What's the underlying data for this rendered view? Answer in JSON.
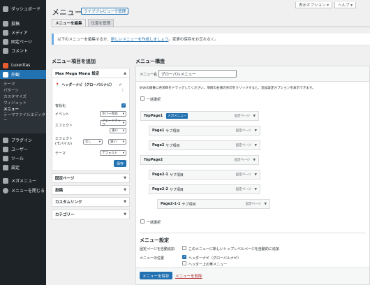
{
  "sidebar": {
    "dashboard": "ダッシュボード",
    "items": [
      "投稿",
      "メディア",
      "固定ページ",
      "コメント"
    ],
    "luxeritas": "Luxeritas",
    "appearance": "外観",
    "appearance_sub": [
      "テーマ",
      "パターン",
      "カスタマイズ",
      "ウィジェット",
      "メニュー",
      "テーマファイルエディター"
    ],
    "items2": [
      "プラグイン",
      "ユーザー",
      "ツール",
      "設定"
    ],
    "megamenu": "メガメニュー",
    "collapse": "メニューを閉じる"
  },
  "header": {
    "screen_options": "表示オプション ▾",
    "help": "ヘルプ ▾",
    "title": "メニュー",
    "live_preview": "ライブプレビューで管理"
  },
  "tabs": [
    "メニューを編集",
    "位置を管理"
  ],
  "notice": {
    "prefix": "以下のメニューを編集するか、",
    "link": "新しいメニューを作成しましょう",
    "suffix": "。変更の保存をお忘れなく。"
  },
  "left": {
    "heading": "メニュー項目を追加",
    "mega_panel_title": "Max Mega Menu 設定",
    "location_label": "ヘッダーナビ（グローバルナビ）",
    "enable_label": "有効化",
    "event_label": "イベント",
    "event_value": "ホバー有効",
    "effect_label": "エフェクト",
    "effect_value": "フェードアップ",
    "speed_value": "速い",
    "effect_mobile_label": "エフェクト (モバイル)",
    "effect_mobile_value": "なし",
    "effect_mobile_speed": "速い",
    "theme_label": "テーマ",
    "theme_value": "デフォルト",
    "save_label": "保存",
    "accordions": [
      "固定ページ",
      "投稿",
      "カスタムリンク",
      "カテゴリー"
    ]
  },
  "right": {
    "heading": "メニュー構造",
    "name_label": "メニュー名",
    "name_value": "グローバルメニュー",
    "instruction": "好みの順番に各項目をドラッグしてください。項目の右側の矢印をクリックすると、追加設定オプションを表示できます。",
    "bulk_select": "一括選択",
    "items": [
      {
        "title": "TopPage1",
        "sub": "",
        "mega": "メガメニュー",
        "type": "固定ページ"
      },
      {
        "title": "Page1",
        "sub": "サブ項目",
        "mega": "",
        "type": "固定ページ"
      },
      {
        "title": "Page2",
        "sub": "サブ項目",
        "mega": "",
        "type": "固定ページ"
      },
      {
        "title": "TopPage2",
        "sub": "",
        "mega": "",
        "type": "固定ページ"
      },
      {
        "title": "Page2-1",
        "sub": "サブ項目",
        "mega": "",
        "type": "固定ページ"
      },
      {
        "title": "Page2-2",
        "sub": "サブ項目",
        "mega": "",
        "type": "固定ページ"
      },
      {
        "title": "Page2-1-1",
        "sub": "サブ項目",
        "mega": "",
        "type": "固定ページ"
      }
    ],
    "bulk_select2": "一括選択",
    "settings_heading": "メニュー設定",
    "auto_add_label": "固定ページを自動追加",
    "auto_add_option": "このメニューに新しいトップレベルページを自動的に追加",
    "location_label": "メニューの位置",
    "loc_options": [
      "ヘッダーナビ（グローバルナビ）",
      "ヘッダー上の帯メニュー"
    ],
    "save_menu": "メニューを保存",
    "delete_menu": "メニューを削除"
  },
  "colors": {
    "accent": "#2271b1",
    "sidebar": "#1d2327",
    "danger": "#b32d2e"
  }
}
